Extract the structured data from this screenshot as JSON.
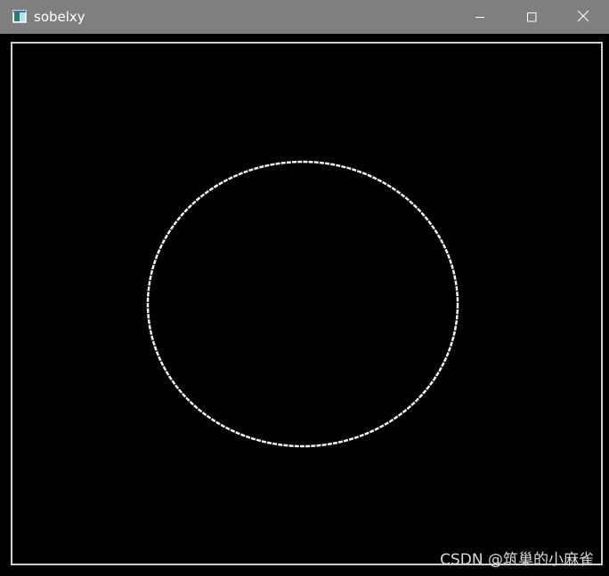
{
  "window": {
    "title": "sobelxy",
    "icon": "opencv-window-icon",
    "controls": [
      "minimize-icon",
      "maximize-icon",
      "close-icon"
    ]
  },
  "image": {
    "description_type": "sobel-edge-output",
    "background_color": "#000000",
    "edge_color": "#ffffff"
  },
  "watermark": {
    "text": "CSDN @筑巢的小麻雀"
  }
}
